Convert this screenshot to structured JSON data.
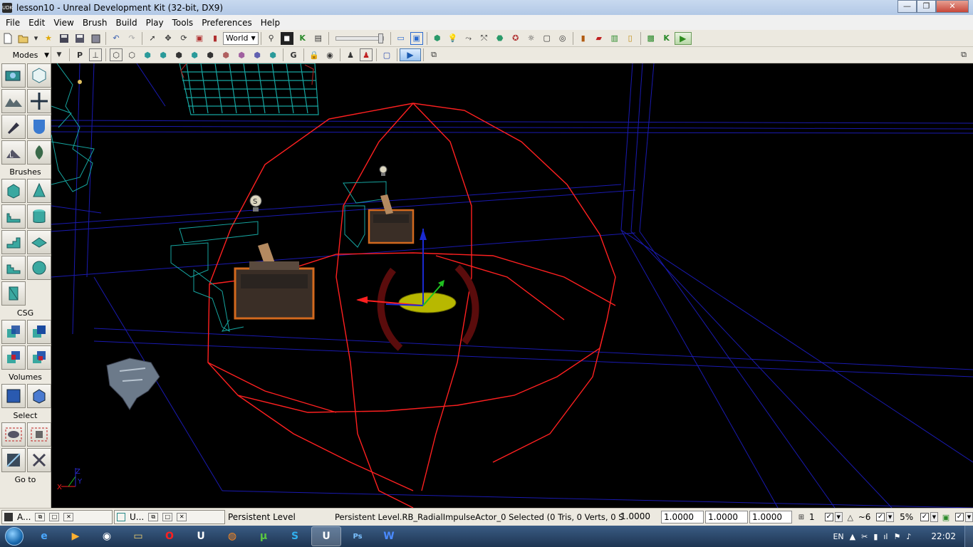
{
  "window": {
    "app_icon_text": "UDK",
    "title": "lesson10 - Unreal Development Kit (32-bit, DX9)",
    "minimize": "—",
    "maximize": "❐",
    "close": "✕"
  },
  "menu": [
    "File",
    "Edit",
    "View",
    "Brush",
    "Build",
    "Play",
    "Tools",
    "Preferences",
    "Help"
  ],
  "toolbar": {
    "coord_system": "World",
    "play_icon": "▶",
    "k_icon": "K"
  },
  "left_panel": {
    "modes_title": "Modes",
    "brushes_title": "Brushes",
    "csg_title": "CSG",
    "volumes_title": "Volumes",
    "select_title": "Select",
    "goto_title": "Go to"
  },
  "viewport": {
    "background": "#000000",
    "wire_color": "#1a1ab0",
    "teal_color": "#16a5a0",
    "radius_color": "#ff2020",
    "axis_labels": {
      "x": "X",
      "y": "Y",
      "z": "Z"
    }
  },
  "statusbar": {
    "mini_window_1": "A...",
    "mini_window_2": "U...",
    "level": "Persistent Level",
    "selection": "Persistent Level.RB_RadialImpulseActor_0 Selected (0 Tris, 0 Verts, 0 S",
    "scale_1": "1.0000",
    "scale_2": "1.0000",
    "scale_3": "1.0000",
    "scale_4": "1.0000",
    "grid_value": "1",
    "rotation_snap": "~6",
    "scale_snap": "5%"
  },
  "taskbar": {
    "language": "EN",
    "clock": "22:02",
    "apps": [
      "ie",
      "media",
      "game",
      "explorer",
      "opera",
      "udk",
      "firefox",
      "utorrent",
      "skype",
      "udk",
      "photoshop",
      "word"
    ]
  }
}
